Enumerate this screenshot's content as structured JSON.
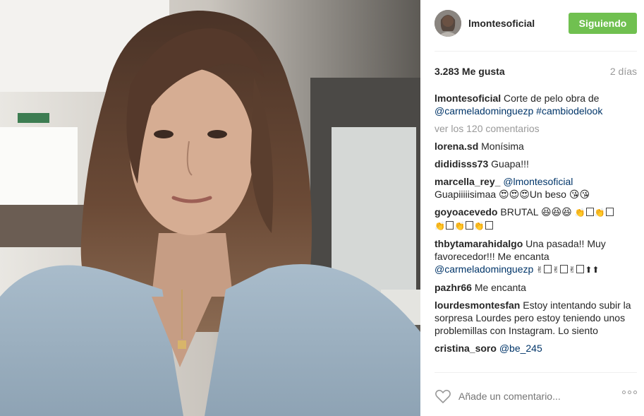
{
  "post": {
    "username": "lmontesoficial",
    "follow_label": "Siguiendo",
    "likes": "3.283 Me gusta",
    "time": "2 días",
    "caption": {
      "user": "lmontesoficial",
      "text": "Corte de pelo obra de",
      "mention": "@carmeladominguezp",
      "hashtag": "#cambiodelook"
    },
    "view_comments": "ver los 120 comentarios",
    "comments": [
      {
        "user": "lorena.sd",
        "text": "Monísima"
      },
      {
        "user": "dididisss73",
        "text": "Guapa!!!"
      },
      {
        "user": "marcella_rey_",
        "mention": "@lmontesoficial",
        "text": "Guapiiiiisimaa 😍😍😍Un beso 😘😘"
      },
      {
        "user": "goyoacevedo",
        "text": "BRUTAL 😆😆😆"
      },
      {
        "user": "thbytamarahidalgo",
        "text": "Una pasada!! Muy favorecedor!!! Me encanta",
        "mention": "@carmeladominguezp"
      },
      {
        "user": "pazhr66",
        "text": "Me encanta"
      },
      {
        "user": "lourdesmontesfan",
        "text": "Estoy intentando subir la sorpresa Lourdes pero estoy teniendo unos problemillas con Instagram. Lo siento"
      },
      {
        "user": "cristina_soro",
        "mention": "@be_245"
      }
    ],
    "add_comment_placeholder": "Añade un comentario..."
  },
  "icons": {
    "like": "heart-outline-icon",
    "options": "more-dots-icon"
  },
  "colors": {
    "follow_button": "#70c050",
    "link": "#003569",
    "muted": "#999999"
  }
}
